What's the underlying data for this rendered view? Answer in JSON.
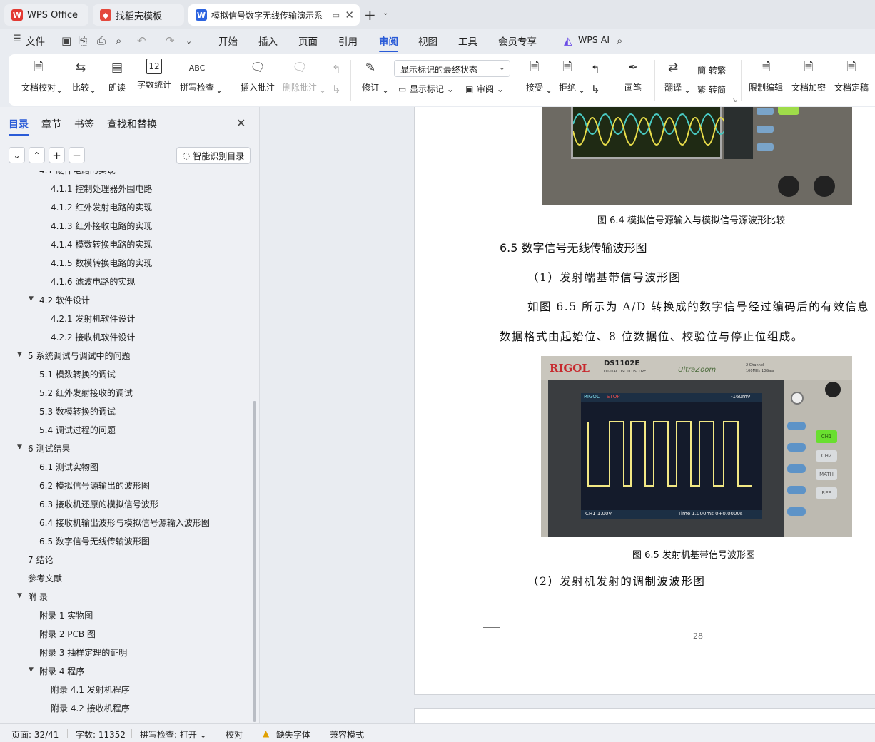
{
  "tabs": [
    {
      "label": "WPS Office",
      "color": "#e23a33"
    },
    {
      "label": "找稻壳模板",
      "color": "#e4483c"
    },
    {
      "label": "模拟信号数字无线传输演示系",
      "color": "#2d64e0"
    }
  ],
  "menu": {
    "file": "文件",
    "items": [
      "开始",
      "插入",
      "页面",
      "引用",
      "审阅",
      "视图",
      "工具",
      "会员专享"
    ],
    "active": "审阅",
    "wps_ai": "WPS AI"
  },
  "ribbon": {
    "doc_check": "文档校对",
    "compare": "比较",
    "read_aloud": "朗读",
    "word_count": "字数统计",
    "spell_check": "拼写检查",
    "insert_comment": "插入批注",
    "delete_comment": "删除批注",
    "revise": "修订",
    "markup_state": "显示标记的最终状态",
    "show_markup": "显示标记",
    "review": "审阅",
    "accept": "接受",
    "reject": "拒绝",
    "pen": "画笔",
    "translate": "翻译",
    "to_traditional": "转繁",
    "to_simplified": "转简",
    "restrict_edit": "限制编辑",
    "encrypt": "文档加密",
    "finalize": "文档定稿"
  },
  "nav": {
    "tabs": [
      "目录",
      "章节",
      "书签",
      "查找和替换"
    ],
    "smart_btn": "智能识别目录",
    "toc": [
      {
        "text": "4.1  硬件电路的实现",
        "level": 2,
        "arrow": true
      },
      {
        "text": "4.1.1  控制处理器外围电路",
        "level": 3
      },
      {
        "text": "4.1.2  红外发射电路的实现",
        "level": 3
      },
      {
        "text": "4.1.3  红外接收电路的实现",
        "level": 3
      },
      {
        "text": "4.1.4  模数转换电路的实现",
        "level": 3
      },
      {
        "text": "4.1.5 数模转换电路的实现",
        "level": 3
      },
      {
        "text": "4.1.6 滤波电路的实现",
        "level": 3
      },
      {
        "text": "4.2  软件设计",
        "level": 2,
        "arrow": true
      },
      {
        "text": "4.2.1  发射机软件设计",
        "level": 3
      },
      {
        "text": "4.2.2  接收机软件设计",
        "level": 3
      },
      {
        "text": "5  系统调试与调试中的问题",
        "level": 1,
        "arrow": true
      },
      {
        "text": "5.1  模数转换的调试",
        "level": 2
      },
      {
        "text": "5.2  红外发射接收的调试",
        "level": 2
      },
      {
        "text": "5.3  数模转换的调试",
        "level": 2
      },
      {
        "text": "5.4  调试过程的问题",
        "level": 2
      },
      {
        "text": "6  测试结果",
        "level": 1,
        "arrow": true
      },
      {
        "text": "6.1  测试实物图",
        "level": 2
      },
      {
        "text": "6.2  模拟信号源输出的波形图",
        "level": 2
      },
      {
        "text": "6.3  接收机还原的模拟信号波形",
        "level": 2
      },
      {
        "text": "6.4  接收机输出波形与模拟信号源输入波形图",
        "level": 2
      },
      {
        "text": "6.5  数字信号无线传输波形图",
        "level": 2
      },
      {
        "text": "7  结论",
        "level": 1
      },
      {
        "text": "参考文献",
        "level": 1
      },
      {
        "text": "附  录",
        "level": 1,
        "arrow": true
      },
      {
        "text": "附录 1  实物图",
        "level": 2
      },
      {
        "text": "附录 2    PCB 图",
        "level": 2
      },
      {
        "text": "附录 3  抽样定理的证明",
        "level": 2
      },
      {
        "text": "附录 4  程序",
        "level": 2,
        "arrow": true
      },
      {
        "text": "附录 4.1  发射机程序",
        "level": 3
      },
      {
        "text": "附录 4.2  接收机程序",
        "level": 3
      }
    ]
  },
  "doc": {
    "fig64_caption": "图 6.4  模拟信号源输入与模拟信号源波形比较",
    "section_heading": "6.5   数字信号无线传输波形图",
    "sub1": "（1）发射端基带信号波形图",
    "para_line1": "如图 6.5 所示为 A/D 转换成的数字信号经过编码后的有效信息",
    "para_line2": "数据格式由起始位、8 位数据位、校验位与停止位组成。",
    "fig65_caption": "图 6.5  发射机基带信号波形图",
    "sub2": "（2）发射机发射的调制波波形图",
    "page_number": "28",
    "scope": {
      "brand": "RIGOL",
      "model": "DS1102E",
      "model_sub": "DIGITAL OSCILLOSCOPE",
      "ultra": "UltraZoom",
      "channels": "2 Channel",
      "bandwidth": "100MHz 1GSa/s",
      "status_run": "RIGOL",
      "status_stop": "STOP",
      "trigger": "-160mV",
      "ch1_scale": "CH1  1.00V",
      "time": "Time 1.000ms  0+0.0000s",
      "ch1_btn": "CH1",
      "ch2_btn": "CH2",
      "math_btn": "MATH",
      "ref_btn": "REF"
    }
  },
  "status": {
    "page": "页面: 32/41",
    "words": "字数: 11352",
    "spell": "拼写检查: 打开",
    "proof": "校对",
    "missing_font": "缺失字体",
    "compat": "兼容模式"
  }
}
